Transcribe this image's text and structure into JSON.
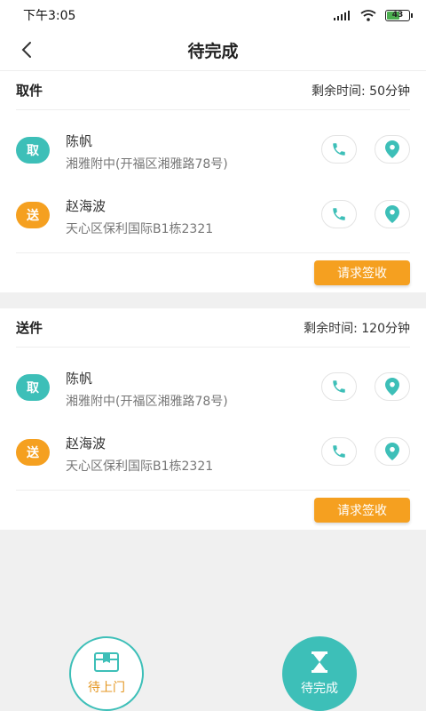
{
  "status_bar": {
    "time": "下午3:05",
    "battery": "43"
  },
  "header": {
    "title": "待完成"
  },
  "cards": [
    {
      "type": "取件",
      "time_label": "剩余时间: 50分钟",
      "rows": [
        {
          "tag": "取",
          "name": "陈帆",
          "address": "湘雅附中(开福区湘雅路78号)"
        },
        {
          "tag": "送",
          "name": "赵海波",
          "address": "天心区保利国际B1栋2321"
        }
      ],
      "action": "请求签收"
    },
    {
      "type": "送件",
      "time_label": "剩余时间: 120分钟",
      "rows": [
        {
          "tag": "取",
          "name": "陈帆",
          "address": "湘雅附中(开福区湘雅路78号)"
        },
        {
          "tag": "送",
          "name": "赵海波",
          "address": "天心区保利国际B1栋2321"
        }
      ],
      "action": "请求签收"
    }
  ],
  "bottom": {
    "waiting_label": "待上门",
    "pending_label": "待完成"
  },
  "colors": {
    "teal": "#3dbfb8",
    "orange": "#f5a020"
  },
  "icons": [
    "back-arrow-icon",
    "signal-icon",
    "wifi-icon",
    "battery-icon",
    "phone-icon",
    "location-pin-icon",
    "box-icon",
    "hourglass-icon"
  ]
}
